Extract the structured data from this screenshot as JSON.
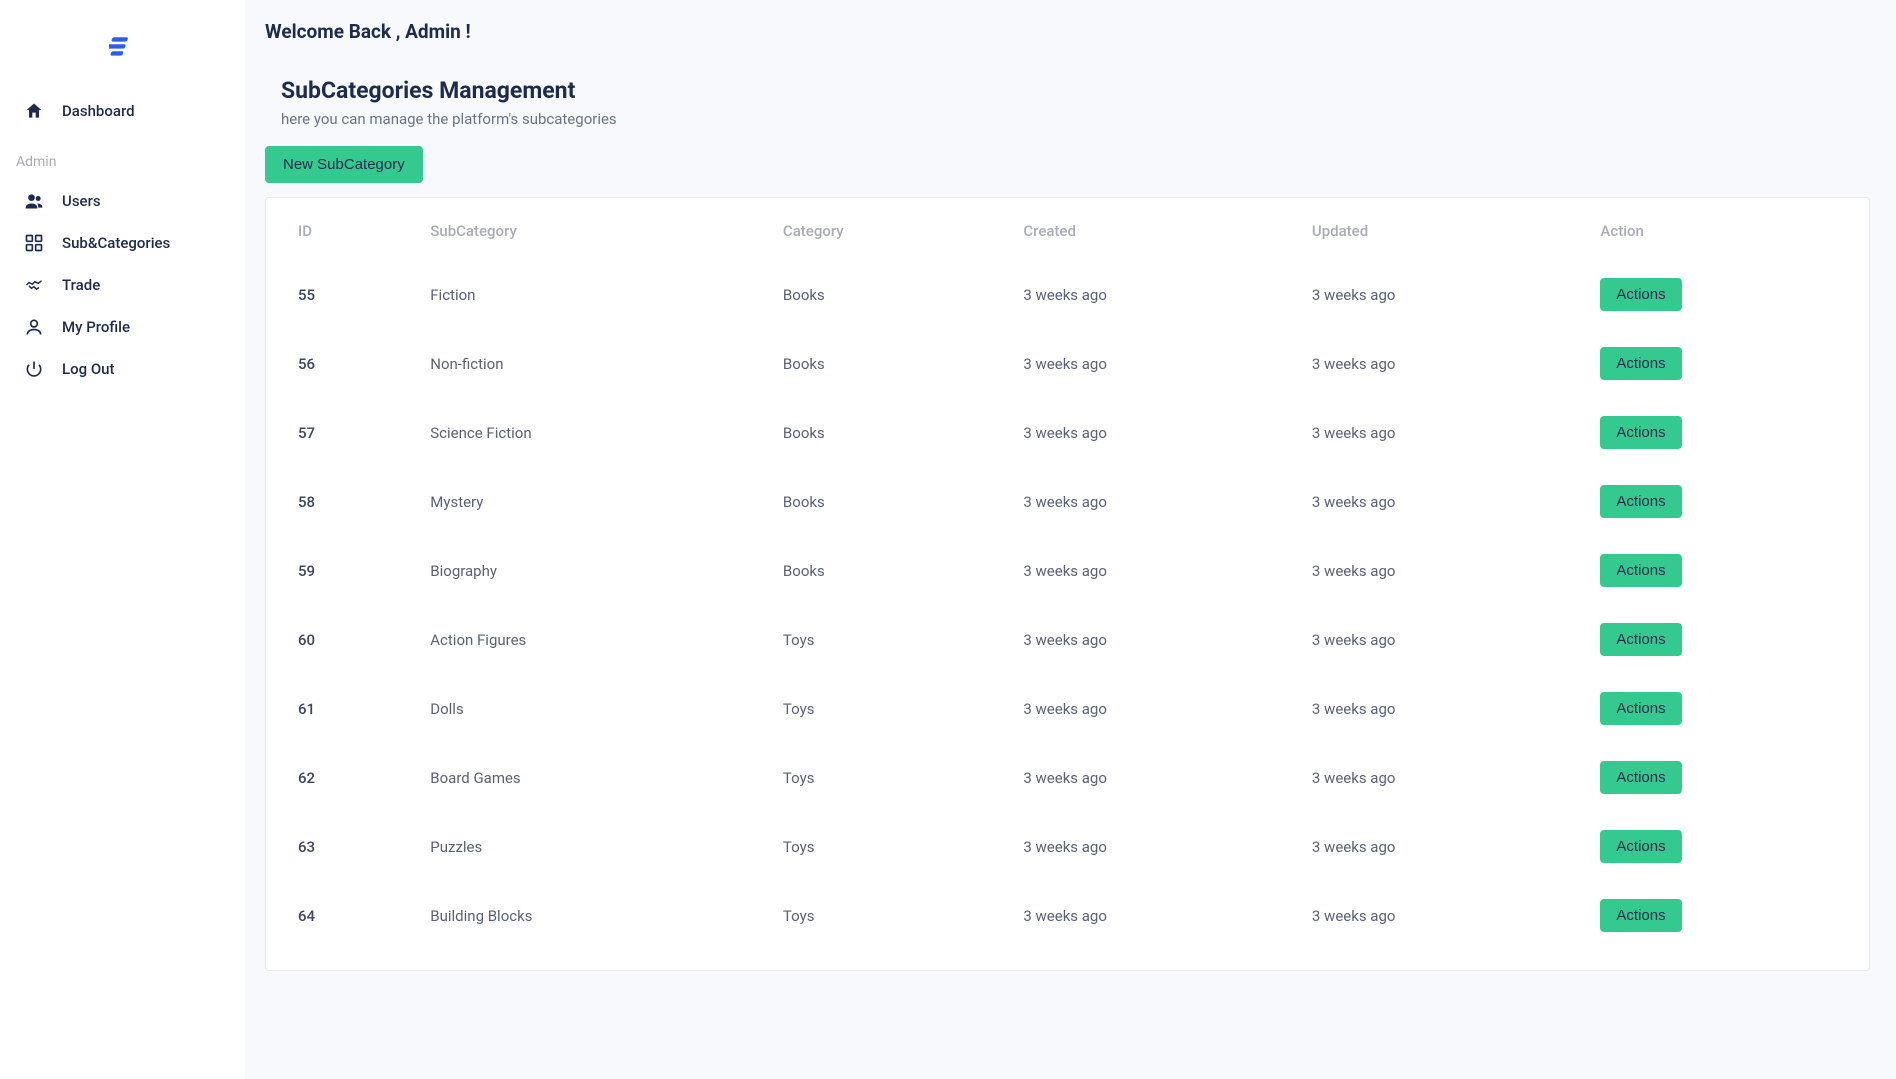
{
  "welcome": "Welcome Back , Admin !",
  "page": {
    "title": "SubCategories Management",
    "subtitle": "here you can manage the platform's subcategories",
    "new_button": "New SubCategory"
  },
  "sidebar": {
    "section_label": "Admin",
    "items": [
      {
        "label": "Dashboard"
      },
      {
        "label": "Users"
      },
      {
        "label": "Sub&Categories"
      },
      {
        "label": "Trade"
      },
      {
        "label": "My Profile"
      },
      {
        "label": "Log Out"
      }
    ]
  },
  "table": {
    "headers": {
      "id": "ID",
      "subcategory": "SubCategory",
      "category": "Category",
      "created": "Created",
      "updated": "Updated",
      "action": "Action"
    },
    "action_label": "Actions",
    "rows": [
      {
        "id": "55",
        "sub": "Fiction",
        "cat": "Books",
        "created": "3 weeks ago",
        "updated": "3 weeks ago"
      },
      {
        "id": "56",
        "sub": "Non-fiction",
        "cat": "Books",
        "created": "3 weeks ago",
        "updated": "3 weeks ago"
      },
      {
        "id": "57",
        "sub": "Science Fiction",
        "cat": "Books",
        "created": "3 weeks ago",
        "updated": "3 weeks ago"
      },
      {
        "id": "58",
        "sub": "Mystery",
        "cat": "Books",
        "created": "3 weeks ago",
        "updated": "3 weeks ago"
      },
      {
        "id": "59",
        "sub": "Biography",
        "cat": "Books",
        "created": "3 weeks ago",
        "updated": "3 weeks ago"
      },
      {
        "id": "60",
        "sub": "Action Figures",
        "cat": "Toys",
        "created": "3 weeks ago",
        "updated": "3 weeks ago"
      },
      {
        "id": "61",
        "sub": "Dolls",
        "cat": "Toys",
        "created": "3 weeks ago",
        "updated": "3 weeks ago"
      },
      {
        "id": "62",
        "sub": "Board Games",
        "cat": "Toys",
        "created": "3 weeks ago",
        "updated": "3 weeks ago"
      },
      {
        "id": "63",
        "sub": "Puzzles",
        "cat": "Toys",
        "created": "3 weeks ago",
        "updated": "3 weeks ago"
      },
      {
        "id": "64",
        "sub": "Building Blocks",
        "cat": "Toys",
        "created": "3 weeks ago",
        "updated": "3 weeks ago"
      }
    ]
  }
}
